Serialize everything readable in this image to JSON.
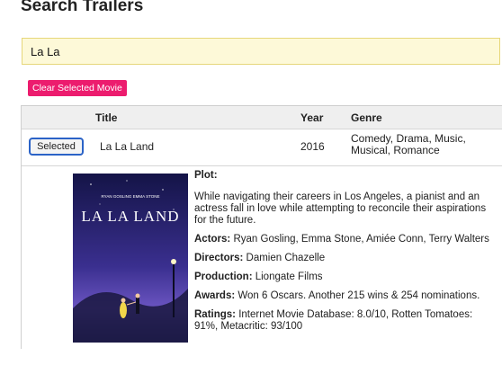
{
  "page": {
    "title": "Search Trailers"
  },
  "search": {
    "value": "La La"
  },
  "actions": {
    "clear_label": "Clear Selected Movie"
  },
  "table": {
    "headers": {
      "title": "Title",
      "year": "Year",
      "genre": "Genre"
    },
    "row": {
      "button_label": "Selected",
      "title": "La La Land",
      "year": "2016",
      "genre": "Comedy, Drama, Music, Musical, Romance"
    }
  },
  "poster": {
    "credits": "RYAN GOSLING   EMMA STONE",
    "title": "LA LA LAND"
  },
  "details": {
    "plot_label": "Plot:",
    "plot": "While navigating their careers in Los Angeles, a pianist and an actress fall in love while attempting to reconcile their aspirations for the future.",
    "actors_label": "Actors:",
    "actors": "Ryan Gosling, Emma Stone, Amiée Conn, Terry Walters",
    "directors_label": "Directors:",
    "directors": "Damien Chazelle",
    "production_label": "Production:",
    "production": "Liongate Films",
    "awards_label": "Awards:",
    "awards": "Won 6 Oscars. Another 215 wins & 254 nominations.",
    "ratings_label": "Ratings:",
    "ratings": "Internet Movie Database: 8.0/10, Rotten Tomatoes: 91%, Metacritic: 93/100"
  }
}
